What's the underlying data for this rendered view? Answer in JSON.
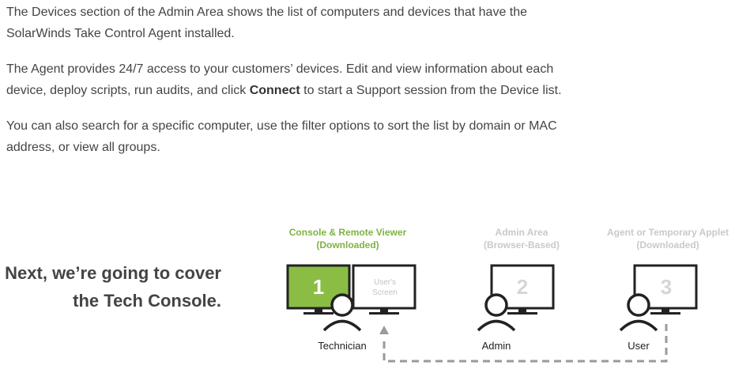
{
  "intro": {
    "p1": "The Devices section of the Admin Area shows the list of computers and devices that have the SolarWinds Take Control Agent installed.",
    "p2_before": "The Agent provides 24/7 access to your customers’ devices. Edit and view information about each device, deploy scripts, run audits, and click ",
    "p2_bold": "Connect",
    "p2_after": " to start a Support session from the Device list.",
    "p3": "You can also search for a specific computer, use the filter options to sort the list by domain or MAC address, or view all groups."
  },
  "next": {
    "line1": "Next, we’re going to cover",
    "line2": "the Tech Console."
  },
  "diagram": {
    "console_title": "Console & Remote Viewer",
    "console_sub": "(Downloaded)",
    "admin_title": "Admin Area",
    "admin_sub": "(Browser-Based)",
    "agent_title": "Agent or Temporary Applet",
    "agent_sub": "(Downloaded)",
    "screen1_number": "1",
    "screen2_number": "2",
    "screen3_number": "3",
    "users_screen_line1": "User's",
    "users_screen_line2": "Screen",
    "technician_label": "Technician",
    "admin_label": "Admin",
    "user_label": "User",
    "colors": {
      "accent_green": "#8bbd45",
      "label_green": "#7fb241",
      "muted_gray": "#c9c9c9",
      "dark": "#222222",
      "dashed": "#9a9a9a"
    },
    "icons": [
      "monitor-icon",
      "person-icon",
      "arrow-up-icon"
    ]
  }
}
